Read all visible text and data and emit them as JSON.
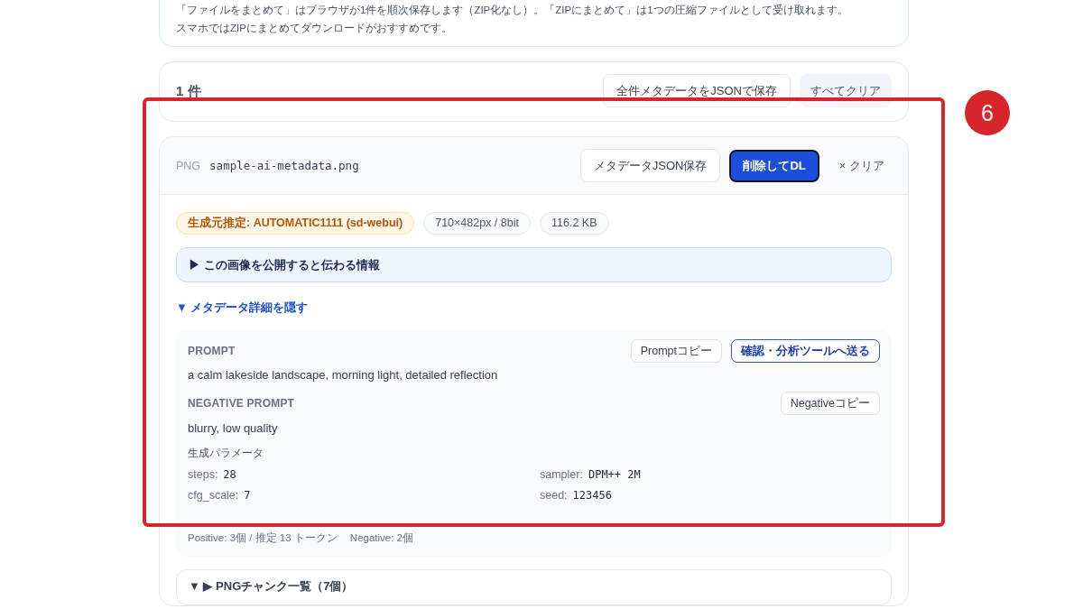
{
  "notice": {
    "lines": [
      "「ファイルをまとめて」はブラウザが1件を順次保存します（ZIP化なし）。「ZIPにまとめて」は1つの圧縮ファイルとして受け取れます。",
      "スマホではZIPにまとめてダウンロードがおすすめです。"
    ]
  },
  "summary": {
    "count": "1 件",
    "buttons": [
      {
        "label": "全件メタデータをJSONで保存",
        "kind": "outline"
      },
      {
        "label": "すべてクリア",
        "kind": "muted"
      }
    ]
  },
  "file": {
    "format": "PNG",
    "name": "sample-ai-metadata.png",
    "actions": [
      {
        "label": "メタデータJSON保存",
        "kind": "outline"
      },
      {
        "label": "削除してDL",
        "kind": "primary"
      },
      {
        "label": "× クリア",
        "kind": "text"
      }
    ],
    "badges": [
      {
        "text": "生成元推定: AUTOMATIC1111 (sd-webui)",
        "kind": "source"
      },
      {
        "text": "710×482px / 8bit",
        "kind": "info"
      },
      {
        "text": "116.2 KB",
        "kind": "info"
      }
    ],
    "disclosure": {
      "marker": "▶",
      "label": "この画像を公開すると伝わる情報"
    },
    "details_toggle": {
      "marker": "▼",
      "label": "メタデータ詳細を隠す"
    },
    "metadata": {
      "sections": [
        {
          "heading": "PROMPT",
          "text": "a calm lakeside landscape, morning light, detailed reflection",
          "buttons": [
            {
              "label": "Promptコピー",
              "kind": "outline"
            },
            {
              "label": "確認・分析ツールへ送る",
              "kind": "accent"
            }
          ]
        },
        {
          "heading": "NEGATIVE PROMPT",
          "text": "blurry, low quality",
          "buttons": [
            {
              "label": "Negativeコピー",
              "kind": "outline"
            }
          ]
        }
      ],
      "params_heading": "生成パラメータ",
      "params": [
        {
          "key": "steps:",
          "value": "28"
        },
        {
          "key": "sampler:",
          "value": "DPM++ 2M"
        },
        {
          "key": "cfg_scale:",
          "value": "7"
        },
        {
          "key": "seed:",
          "value": "123456"
        }
      ],
      "token_summary": [
        "Positive: 3個 / 推定 13 トークン",
        "Negative: 2個"
      ]
    },
    "chunks": {
      "label": "▼ ▶ PNGチャンク一覧（7個）"
    }
  },
  "annotation": {
    "number": "6"
  }
}
